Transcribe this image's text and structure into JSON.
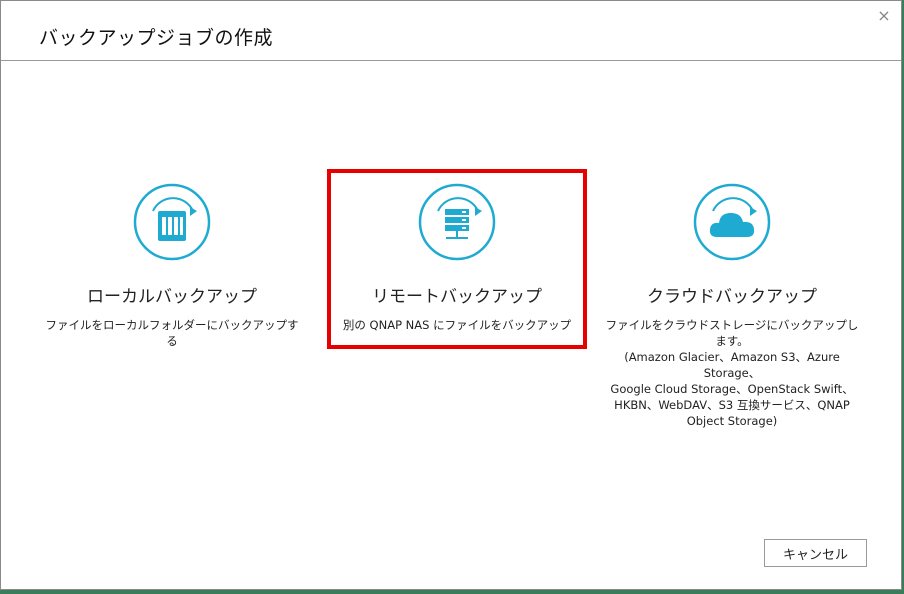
{
  "dialog": {
    "title": "バックアップジョブの作成",
    "close_glyph": "×"
  },
  "options": [
    {
      "title": "ローカルバックアップ",
      "description": "ファイルをローカルフォルダーにバックアップする",
      "icon": "nas-device-icon",
      "selected": false
    },
    {
      "title": "リモートバックアップ",
      "description": "別の QNAP NAS にファイルをバックアップ",
      "icon": "server-rack-icon",
      "selected": true
    },
    {
      "title": "クラウドバックアップ",
      "description_lines": [
        "ファイルをクラウドストレージにバックアップします。",
        "(Amazon Glacier、Amazon S3、Azure Storage、",
        "Google Cloud Storage、OpenStack Swift、",
        "HKBN、WebDAV、S3 互換サービス、QNAP",
        "Object Storage)"
      ],
      "icon": "cloud-icon",
      "selected": false
    }
  ],
  "footer": {
    "cancel_label": "キャンセル"
  },
  "colors": {
    "accent": "#1eaad1",
    "selection_border": "#e60000"
  }
}
